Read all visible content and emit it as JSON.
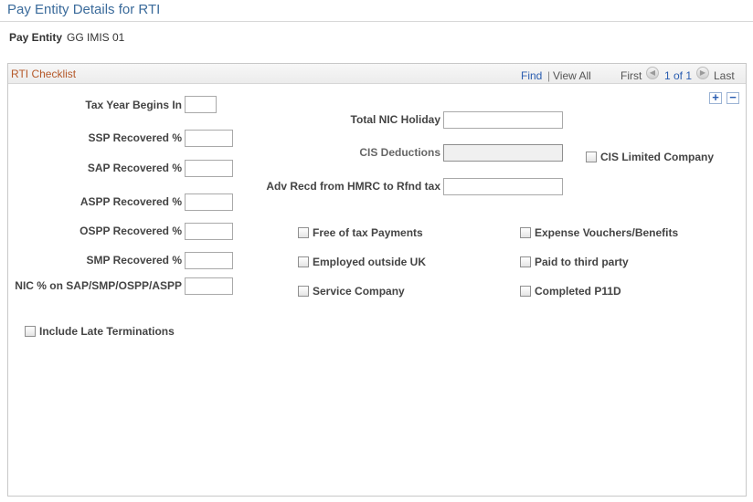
{
  "page": {
    "title": "Pay Entity Details for RTI",
    "pay_entity_label": "Pay Entity",
    "pay_entity_value": "GG IMIS 01"
  },
  "panel": {
    "title": "RTI Checklist",
    "nav": {
      "find": "Find",
      "separator": "|",
      "view_all": "View All",
      "first": "First",
      "count": "1 of 1",
      "last": "Last"
    },
    "add_symbol": "+",
    "delete_symbol": "−"
  },
  "fields": {
    "tax_year_begins_in": {
      "label": "Tax Year Begins In",
      "value": ""
    },
    "ssp_recovered": {
      "label": "SSP Recovered %",
      "value": ""
    },
    "sap_recovered": {
      "label": "SAP Recovered %",
      "value": ""
    },
    "aspp_recovered": {
      "label": "ASPP Recovered %",
      "value": ""
    },
    "ospp_recovered": {
      "label": "OSPP Recovered %",
      "value": ""
    },
    "smp_recovered": {
      "label": "SMP Recovered %",
      "value": ""
    },
    "nic_pct": {
      "label": "NIC % on SAP/SMP/OSPP/ASPP",
      "value": ""
    },
    "total_nic_holiday": {
      "label": "Total NIC Holiday",
      "value": ""
    },
    "cis_deductions": {
      "label": "CIS Deductions",
      "value": ""
    },
    "adv_recd": {
      "label": "Adv Recd from HMRC to Rfnd tax",
      "value": ""
    }
  },
  "checkboxes": {
    "cis_limited_company": {
      "label": "CIS Limited Company",
      "checked": false
    },
    "free_of_tax_payments": {
      "label": "Free of tax Payments",
      "checked": false
    },
    "employed_outside_uk": {
      "label": "Employed outside UK",
      "checked": false
    },
    "service_company": {
      "label": "Service Company",
      "checked": false
    },
    "expense_vouchers": {
      "label": "Expense Vouchers/Benefits",
      "checked": false
    },
    "paid_to_third_party": {
      "label": "Paid to third party",
      "checked": false
    },
    "completed_p11d": {
      "label": "Completed P11D",
      "checked": false
    },
    "include_late_terminations": {
      "label": "Include Late Terminations",
      "checked": false
    }
  },
  "icons": {
    "prev": "previous-arrow-icon",
    "next": "next-arrow-icon"
  },
  "colors": {
    "title": "#3b6b9b",
    "panel_title": "#b5592a",
    "link": "#2a5db0"
  }
}
